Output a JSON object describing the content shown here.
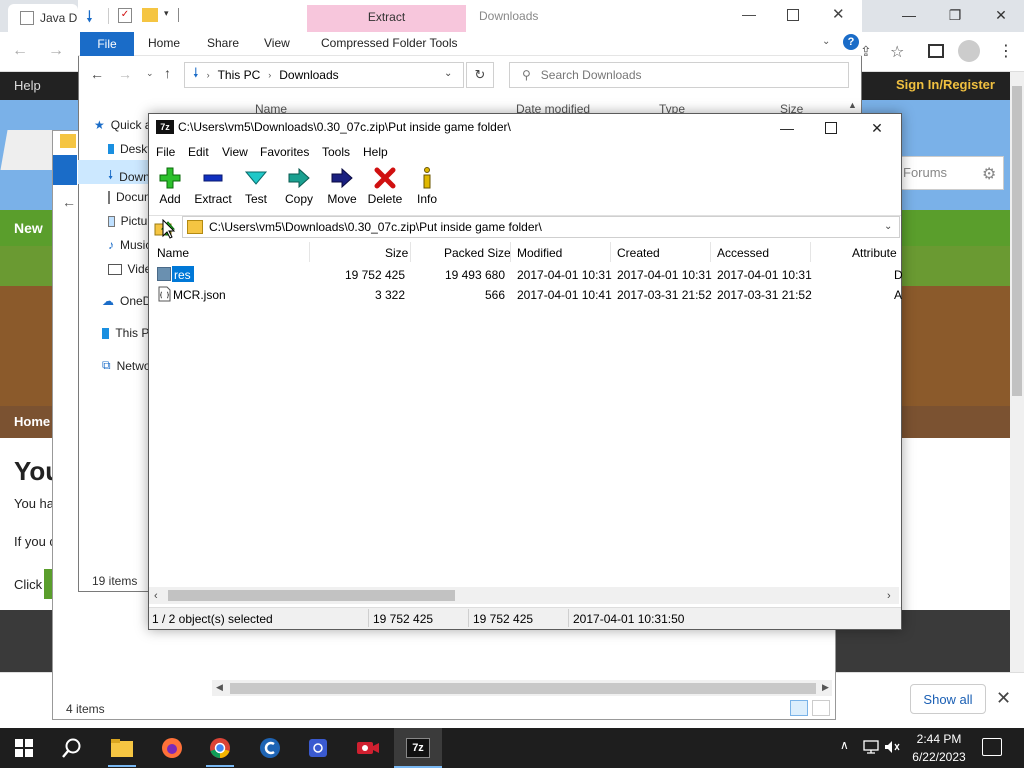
{
  "browser": {
    "tab_title": "Java D",
    "site": {
      "help": "Help",
      "sign_in": "Sign In/Register",
      "forums_placeholder": "Forums",
      "news_link": "New",
      "home_tab": "Home",
      "heading_fragment": "You",
      "line1_fragment": "You ha",
      "line2_fragment": "If you c",
      "line3_fragment": "Click"
    },
    "show_all": "Show all"
  },
  "explorer_behind": {
    "status": "4 items"
  },
  "explorer": {
    "title": "Downloads",
    "contextual_tab": "Extract",
    "ribbon_tabs": [
      "File",
      "Home",
      "Share",
      "View",
      "Compressed Folder Tools"
    ],
    "breadcrumb": [
      "This PC",
      "Downloads"
    ],
    "search_placeholder": "Search Downloads",
    "nav_items": [
      "Quick access",
      "Desktop",
      "Downloads",
      "Documents",
      "Pictures",
      "Music",
      "Videos",
      "OneDrive",
      "This PC",
      "Network"
    ],
    "columns": {
      "name": "Name",
      "date": "Date modified",
      "type": "Type",
      "size": "Size"
    },
    "status": "19 items"
  },
  "sevenzip": {
    "title": "C:\\Users\\vm5\\Downloads\\0.30_07c.zip\\Put inside game folder\\",
    "icon_text": "7z",
    "menu": [
      "File",
      "Edit",
      "View",
      "Favorites",
      "Tools",
      "Help"
    ],
    "toolbar": [
      {
        "label": "Add",
        "icon": "add-icon",
        "color": "#22aa22"
      },
      {
        "label": "Extract",
        "icon": "extract-icon",
        "color": "#1030c0"
      },
      {
        "label": "Test",
        "icon": "test-icon",
        "color": "#16b0b0"
      },
      {
        "label": "Copy",
        "icon": "copy-icon",
        "color": "#1aa090"
      },
      {
        "label": "Move",
        "icon": "move-icon",
        "color": "#1a2080"
      },
      {
        "label": "Delete",
        "icon": "delete-icon",
        "color": "#d01010"
      },
      {
        "label": "Info",
        "icon": "info-icon",
        "color": "#d4b000"
      }
    ],
    "path": "C:\\Users\\vm5\\Downloads\\0.30_07c.zip\\Put inside game folder\\",
    "columns": [
      "Name",
      "Size",
      "Packed Size",
      "Modified",
      "Created",
      "Accessed",
      "Attribute"
    ],
    "rows": [
      {
        "name": "res",
        "size": "19 752 425",
        "packed": "19 493 680",
        "modified": "2017-04-01 10:31",
        "created": "2017-04-01 10:31",
        "accessed": "2017-04-01 10:31",
        "attr": "D",
        "kind": "folder",
        "selected": true
      },
      {
        "name": "MCR.json",
        "size": "3 322",
        "packed": "566",
        "modified": "2017-04-01 10:41",
        "created": "2017-03-31 21:52",
        "accessed": "2017-03-31 21:52",
        "attr": "A",
        "kind": "file",
        "selected": false
      }
    ],
    "status": {
      "selection": "1 / 2 object(s) selected",
      "size": "19 752 425",
      "packed": "19 752 425",
      "modified": "2017-04-01 10:31:50"
    }
  },
  "taskbar": {
    "time": "2:44 PM",
    "date": "6/22/2023",
    "apps": [
      "file-explorer-icon",
      "firefox-icon",
      "chrome-icon",
      "ccleaner-icon",
      "app-icon",
      "recorder-icon",
      "7zip-icon"
    ]
  }
}
